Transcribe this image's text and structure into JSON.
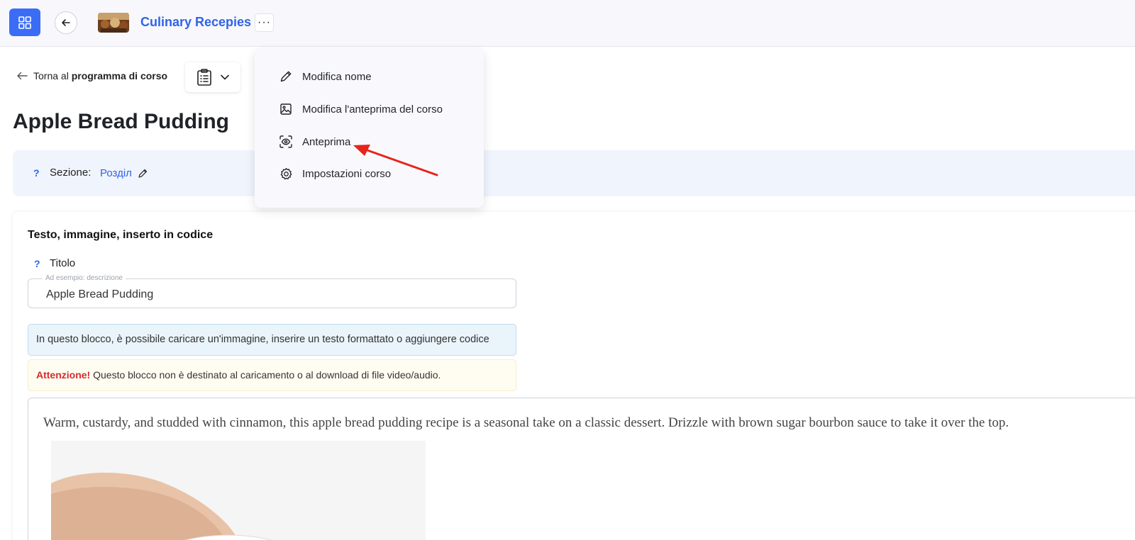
{
  "header": {
    "course_title": "Culinary Recepies",
    "more_label": "···"
  },
  "breadcrumb": {
    "back_prefix": "Torna al",
    "back_target": "programma di corso"
  },
  "page": {
    "title": "Apple Bread Pudding"
  },
  "section": {
    "help": "?",
    "label": "Sezione:",
    "value": "Розділ"
  },
  "block": {
    "heading": "Testo, immagine, inserto in codice",
    "title_help": "?",
    "title_label": "Titolo",
    "title_placeholder": "Ad esempio: descrizione",
    "title_value": "Apple Bread Pudding",
    "info_text": "In questo blocco, è possibile caricare un'immagine, inserire un testo formattato o aggiungere codice",
    "warning_prefix": "Attenzione!",
    "warning_text": " Questo blocco non è destinato al caricamento o al download di file video/audio.",
    "editor_text": "Warm, custardy, and studded with cinnamon, this apple bread pudding recipe is a seasonal take on a classic dessert. Drizzle with brown sugar bourbon sauce to take it over the top."
  },
  "menu": {
    "items": [
      {
        "label": "Modifica nome",
        "icon": "pencil-icon"
      },
      {
        "label": "Modifica l'anteprima del corso",
        "icon": "image-icon"
      },
      {
        "label": "Anteprima",
        "icon": "eye-icon"
      },
      {
        "label": "Impostazioni corso",
        "icon": "gear-icon"
      }
    ]
  },
  "colors": {
    "accent": "#2f63e8",
    "primary_button": "#3b6cf6",
    "warning": "#d62b2b",
    "annotation_arrow": "#e8231b"
  }
}
